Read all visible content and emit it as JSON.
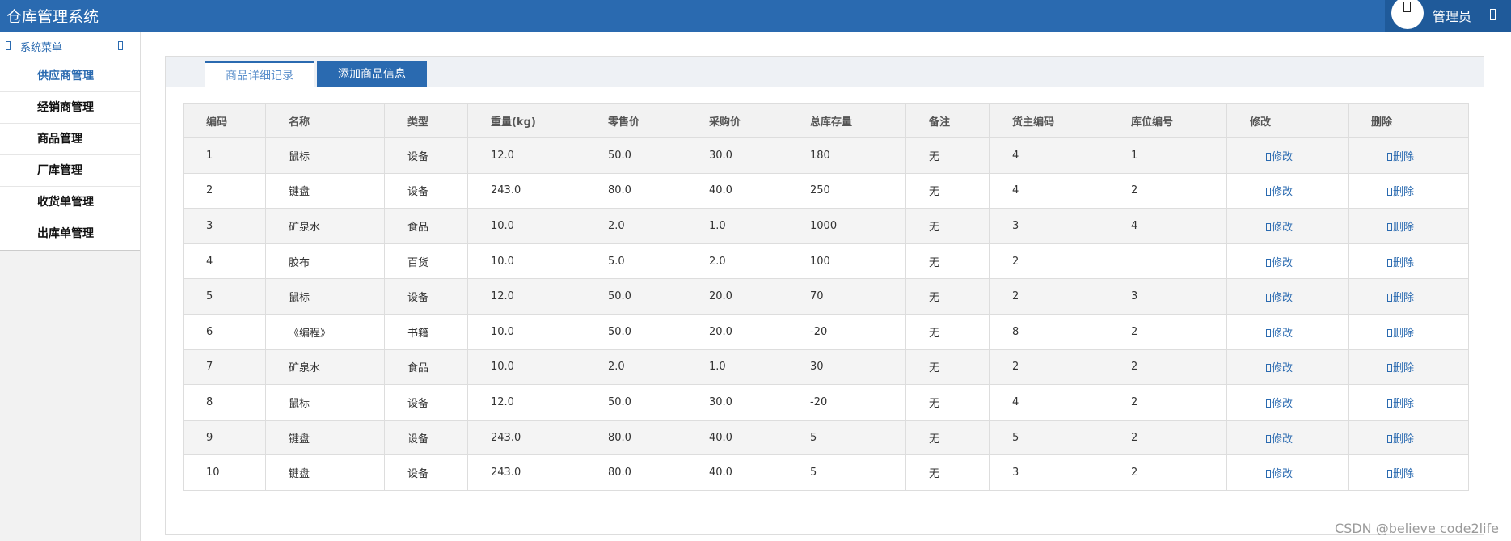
{
  "header": {
    "title": "仓库管理系统",
    "user": "管理员"
  },
  "sidebar": {
    "title": "系统菜单",
    "items": [
      {
        "label": "供应商管理"
      },
      {
        "label": "经销商管理"
      },
      {
        "label": "商品管理"
      },
      {
        "label": "厂库管理"
      },
      {
        "label": "收货单管理"
      },
      {
        "label": "出库单管理"
      }
    ]
  },
  "tabs": [
    {
      "label": "商品详细记录"
    },
    {
      "label": "添加商品信息"
    }
  ],
  "table": {
    "columns": [
      "编码",
      "名称",
      "类型",
      "重量(kg)",
      "零售价",
      "采购价",
      "总库存量",
      "备注",
      "货主编码",
      "库位编号",
      "修改",
      "删除"
    ],
    "edit_label": "修改",
    "delete_label": "删除",
    "rows": [
      [
        "1",
        "鼠标",
        "设备",
        "12.0",
        "50.0",
        "30.0",
        "180",
        "无",
        "4",
        "1"
      ],
      [
        "2",
        "键盘",
        "设备",
        "243.0",
        "80.0",
        "40.0",
        "250",
        "无",
        "4",
        "2"
      ],
      [
        "3",
        "矿泉水",
        "食品",
        "10.0",
        "2.0",
        "1.0",
        "1000",
        "无",
        "3",
        "4"
      ],
      [
        "4",
        "胶布",
        "百货",
        "10.0",
        "5.0",
        "2.0",
        "100",
        "无",
        "2",
        ""
      ],
      [
        "5",
        "鼠标",
        "设备",
        "12.0",
        "50.0",
        "20.0",
        "70",
        "无",
        "2",
        "3"
      ],
      [
        "6",
        "《编程》",
        "书籍",
        "10.0",
        "50.0",
        "20.0",
        "-20",
        "无",
        "8",
        "2"
      ],
      [
        "7",
        "矿泉水",
        "食品",
        "10.0",
        "2.0",
        "1.0",
        "30",
        "无",
        "2",
        "2"
      ],
      [
        "8",
        "鼠标",
        "设备",
        "12.0",
        "50.0",
        "30.0",
        "-20",
        "无",
        "4",
        "2"
      ],
      [
        "9",
        "键盘",
        "设备",
        "243.0",
        "80.0",
        "40.0",
        "5",
        "无",
        "5",
        "2"
      ],
      [
        "10",
        "键盘",
        "设备",
        "243.0",
        "80.0",
        "40.0",
        "5",
        "无",
        "3",
        "2"
      ]
    ]
  },
  "watermark": "CSDN @believe code2life",
  "colors": {
    "primary": "#2a6ab0",
    "header_bg": "#2a6ab0",
    "row_alt": "#f4f4f4"
  }
}
